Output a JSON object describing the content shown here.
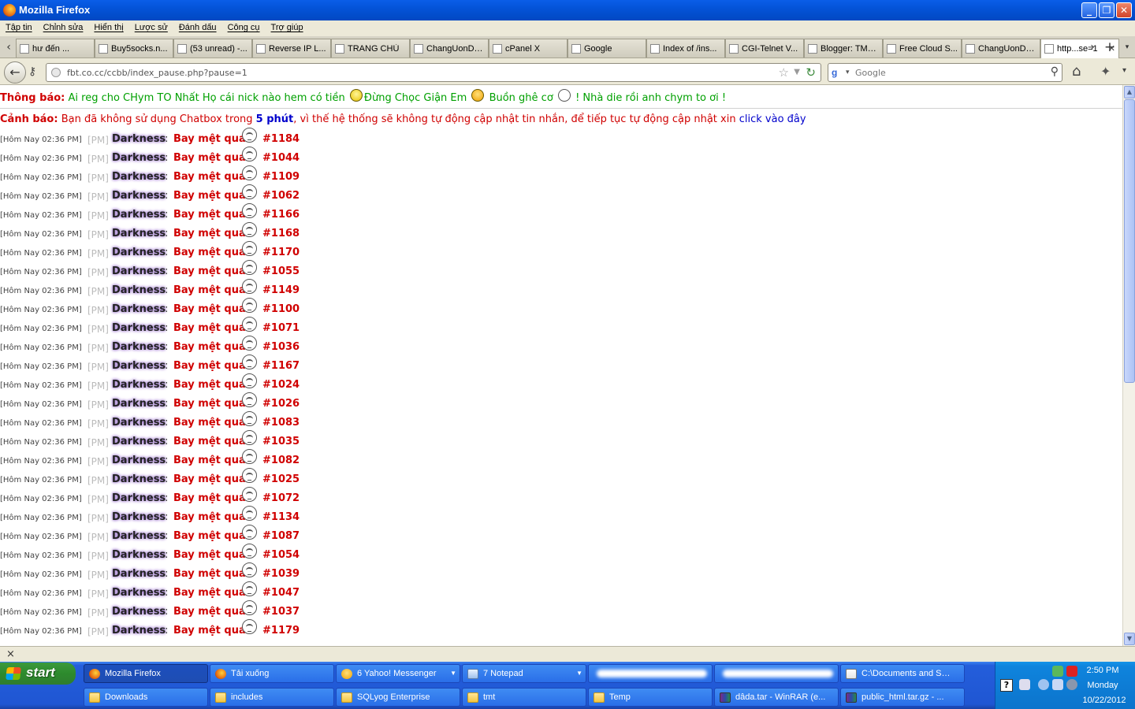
{
  "window": {
    "title": "Mozilla Firefox",
    "controls": {
      "minimize": "_",
      "maximize": "❐",
      "close": "✕"
    }
  },
  "menu": [
    "Tập tin",
    "Chỉnh sửa",
    "Hiển thị",
    "Lược sử",
    "Đánh dấu",
    "Công cụ",
    "Trợ giúp"
  ],
  "tabs": [
    {
      "label": "hư đến ...",
      "icon": "page-icon",
      "active": false
    },
    {
      "label": "Buy5socks.n...",
      "icon": "page-icon",
      "active": false
    },
    {
      "label": "(53 unread) -...",
      "icon": "yahoo-mail-icon",
      "active": false
    },
    {
      "label": "Reverse IP L...",
      "icon": "globe-icon",
      "active": false
    },
    {
      "label": "TRANG CHỦ",
      "icon": "page-icon",
      "active": false
    },
    {
      "label": "ChangUonDy...",
      "icon": "page-icon",
      "active": false
    },
    {
      "label": "cPanel X",
      "icon": "cpanel-icon",
      "active": false
    },
    {
      "label": "Google",
      "icon": "google-icon",
      "active": false
    },
    {
      "label": "Index of /ins...",
      "icon": "page-icon",
      "active": false
    },
    {
      "label": "CGI-Telnet V...",
      "icon": "page-icon",
      "active": false
    },
    {
      "label": "Blogger: TMT...",
      "icon": "blogger-icon",
      "active": false
    },
    {
      "label": "Free Cloud S...",
      "icon": "cloud-icon",
      "active": false
    },
    {
      "label": "ChangUonDy...",
      "icon": "page-icon",
      "active": false
    },
    {
      "label": "http...se=1",
      "icon": "page-icon",
      "active": true
    }
  ],
  "nav": {
    "url": "fbt.co.cc/ccbb/index_pause.php?pause=1",
    "search_placeholder": "Google"
  },
  "notice": {
    "label": "Thông báo:",
    "text1": "Ai reg cho CHym TO Nhất Họ cái nick nào hem có tiền",
    "text2": "Đừng Chọc Giận Em",
    "text3": "Buồn ghê cơ",
    "text4": "! Nhà die rồi anh chym to ơi !"
  },
  "warning": {
    "label": "Cảnh báo:",
    "text1": "Bạn đã không sử dụng Chatbox trong",
    "duration": "5 phút",
    "text2": ", vì thế hệ thống sẽ không tự động cập nhật tin nhắn, để tiếp tục tự động cập nhật xin",
    "link1": "click",
    "link2": "vào đây"
  },
  "message_common": {
    "timestamp": "[Hôm Nay 02:36 PM]",
    "pm": "[PM]",
    "user": "Darkness",
    "colon": ":",
    "text": "Bay mệt quá"
  },
  "messages": [
    "#1184",
    "#1044",
    "#1109",
    "#1062",
    "#1166",
    "#1168",
    "#1170",
    "#1055",
    "#1149",
    "#1100",
    "#1071",
    "#1036",
    "#1167",
    "#1024",
    "#1026",
    "#1083",
    "#1035",
    "#1082",
    "#1025",
    "#1072",
    "#1134",
    "#1087",
    "#1054",
    "#1039",
    "#1047",
    "#1037",
    "#1179"
  ],
  "taskbar": {
    "start": "start",
    "row1": [
      {
        "label": "Mozilla Firefox",
        "icon": "ico-ff",
        "active": true,
        "dropdown": false
      },
      {
        "label": "Tải xuống",
        "icon": "ico-ff",
        "active": false,
        "dropdown": false
      },
      {
        "label": "6 Yahoo! Messenger",
        "icon": "ico-yahoo",
        "active": false,
        "dropdown": true
      },
      {
        "label": "7 Notepad",
        "icon": "ico-notepad",
        "active": false,
        "dropdown": true
      },
      {
        "label": "",
        "icon": "",
        "active": false,
        "dropdown": false,
        "blurred": true
      },
      {
        "label": "",
        "icon": "",
        "active": false,
        "dropdown": false,
        "blurred": true
      },
      {
        "label": "C:\\Documents and Se...",
        "icon": "ico-doc",
        "active": false,
        "dropdown": false
      }
    ],
    "row2": [
      {
        "label": "Downloads",
        "icon": "ico-folder"
      },
      {
        "label": "includes",
        "icon": "ico-folder"
      },
      {
        "label": "SQLyog Enterprise",
        "icon": "ico-folder"
      },
      {
        "label": "tmt",
        "icon": "ico-folder"
      },
      {
        "label": "Temp",
        "icon": "ico-folder"
      },
      {
        "label": "dâda.tar - WinRAR (e...",
        "icon": "ico-winrar"
      },
      {
        "label": "public_html.tar.gz - ...",
        "icon": "ico-winrar"
      }
    ]
  },
  "tray": {
    "help": "?",
    "time": "2:50 PM",
    "day": "Monday",
    "date": "10/22/2012"
  }
}
